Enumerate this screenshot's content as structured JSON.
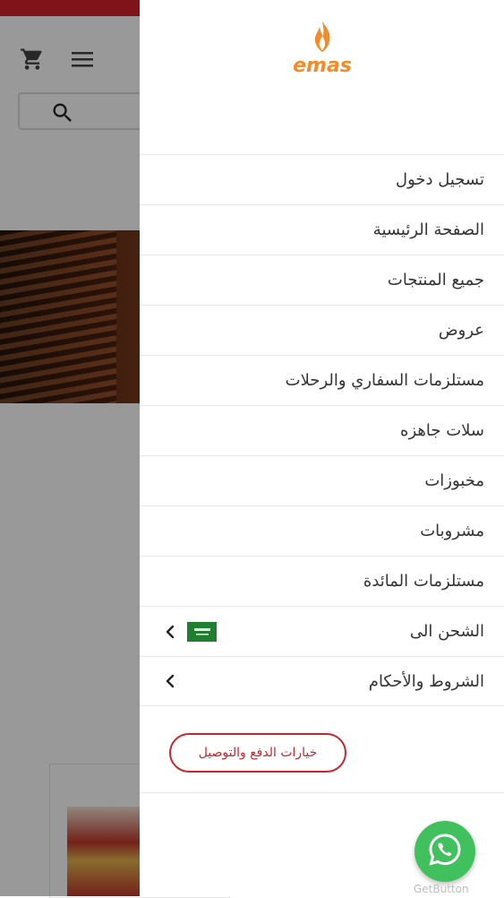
{
  "brand": {
    "logo_text": "emas",
    "logo_color": "#f28c2b"
  },
  "colors": {
    "topbar": "#d61f2c",
    "accent_red": "#c4252e",
    "whatsapp": "#41c15d"
  },
  "menu": {
    "items": [
      {
        "label": "تسجيل دخول"
      },
      {
        "label": "الصفحة الرئيسية"
      },
      {
        "label": "جميع المنتجات"
      },
      {
        "label": "عروض"
      },
      {
        "label": "مستلزمات السفاري والرحلات"
      },
      {
        "label": "سلات جاهزه"
      },
      {
        "label": "مخبوزات"
      },
      {
        "label": "مشروبات"
      },
      {
        "label": "مستلزمات المائدة"
      }
    ],
    "shipping_label": "الشحن الى",
    "terms_label": "الشروط والأحكام",
    "payment_button": "خيارات الدفع والتوصيل"
  },
  "icons": {
    "cart": "shopping-cart-icon",
    "menu": "hamburger-menu-icon",
    "search": "search-icon",
    "chevron": "chevron-left-icon",
    "flag": "saudi-flag-icon",
    "whatsapp": "whatsapp-icon"
  },
  "widget": {
    "getbutton_label": "GetButton"
  }
}
